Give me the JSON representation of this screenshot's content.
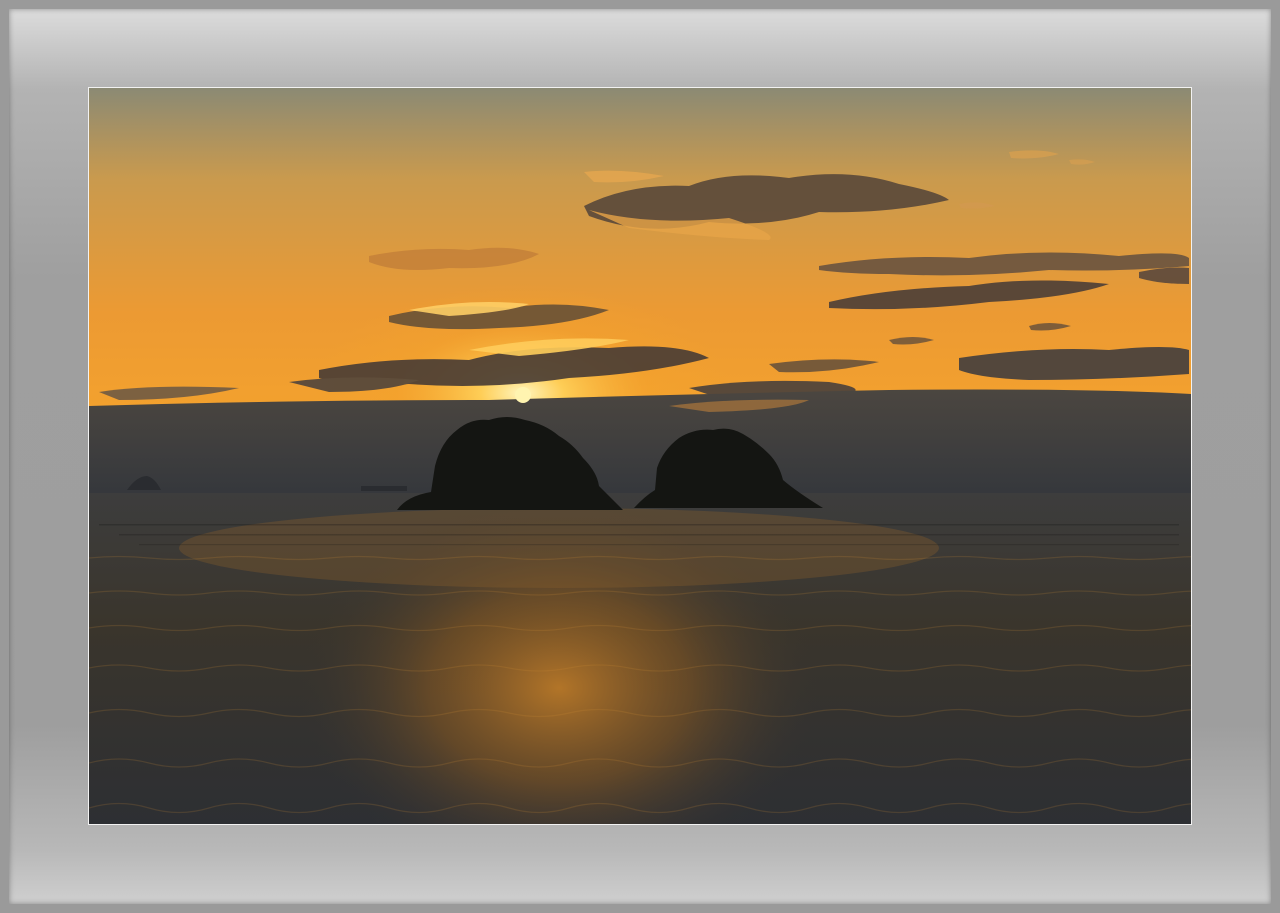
{
  "scene": {
    "subject": "sunset-over-sea-with-two-islands",
    "colors": {
      "sky_top": "#8f8f78",
      "sky_mid": "#e0952e",
      "sky_horizon": "#f4a12a",
      "haze": "#3c3f45",
      "sun": "#fff4b0",
      "sea_dark": "#2c2e33",
      "sea_glow": "#b8782a",
      "island": "#141512",
      "frame_light": "#dcdcdc",
      "frame_dark": "#9e9e9e",
      "mat_border": "#f2f2f2"
    }
  }
}
